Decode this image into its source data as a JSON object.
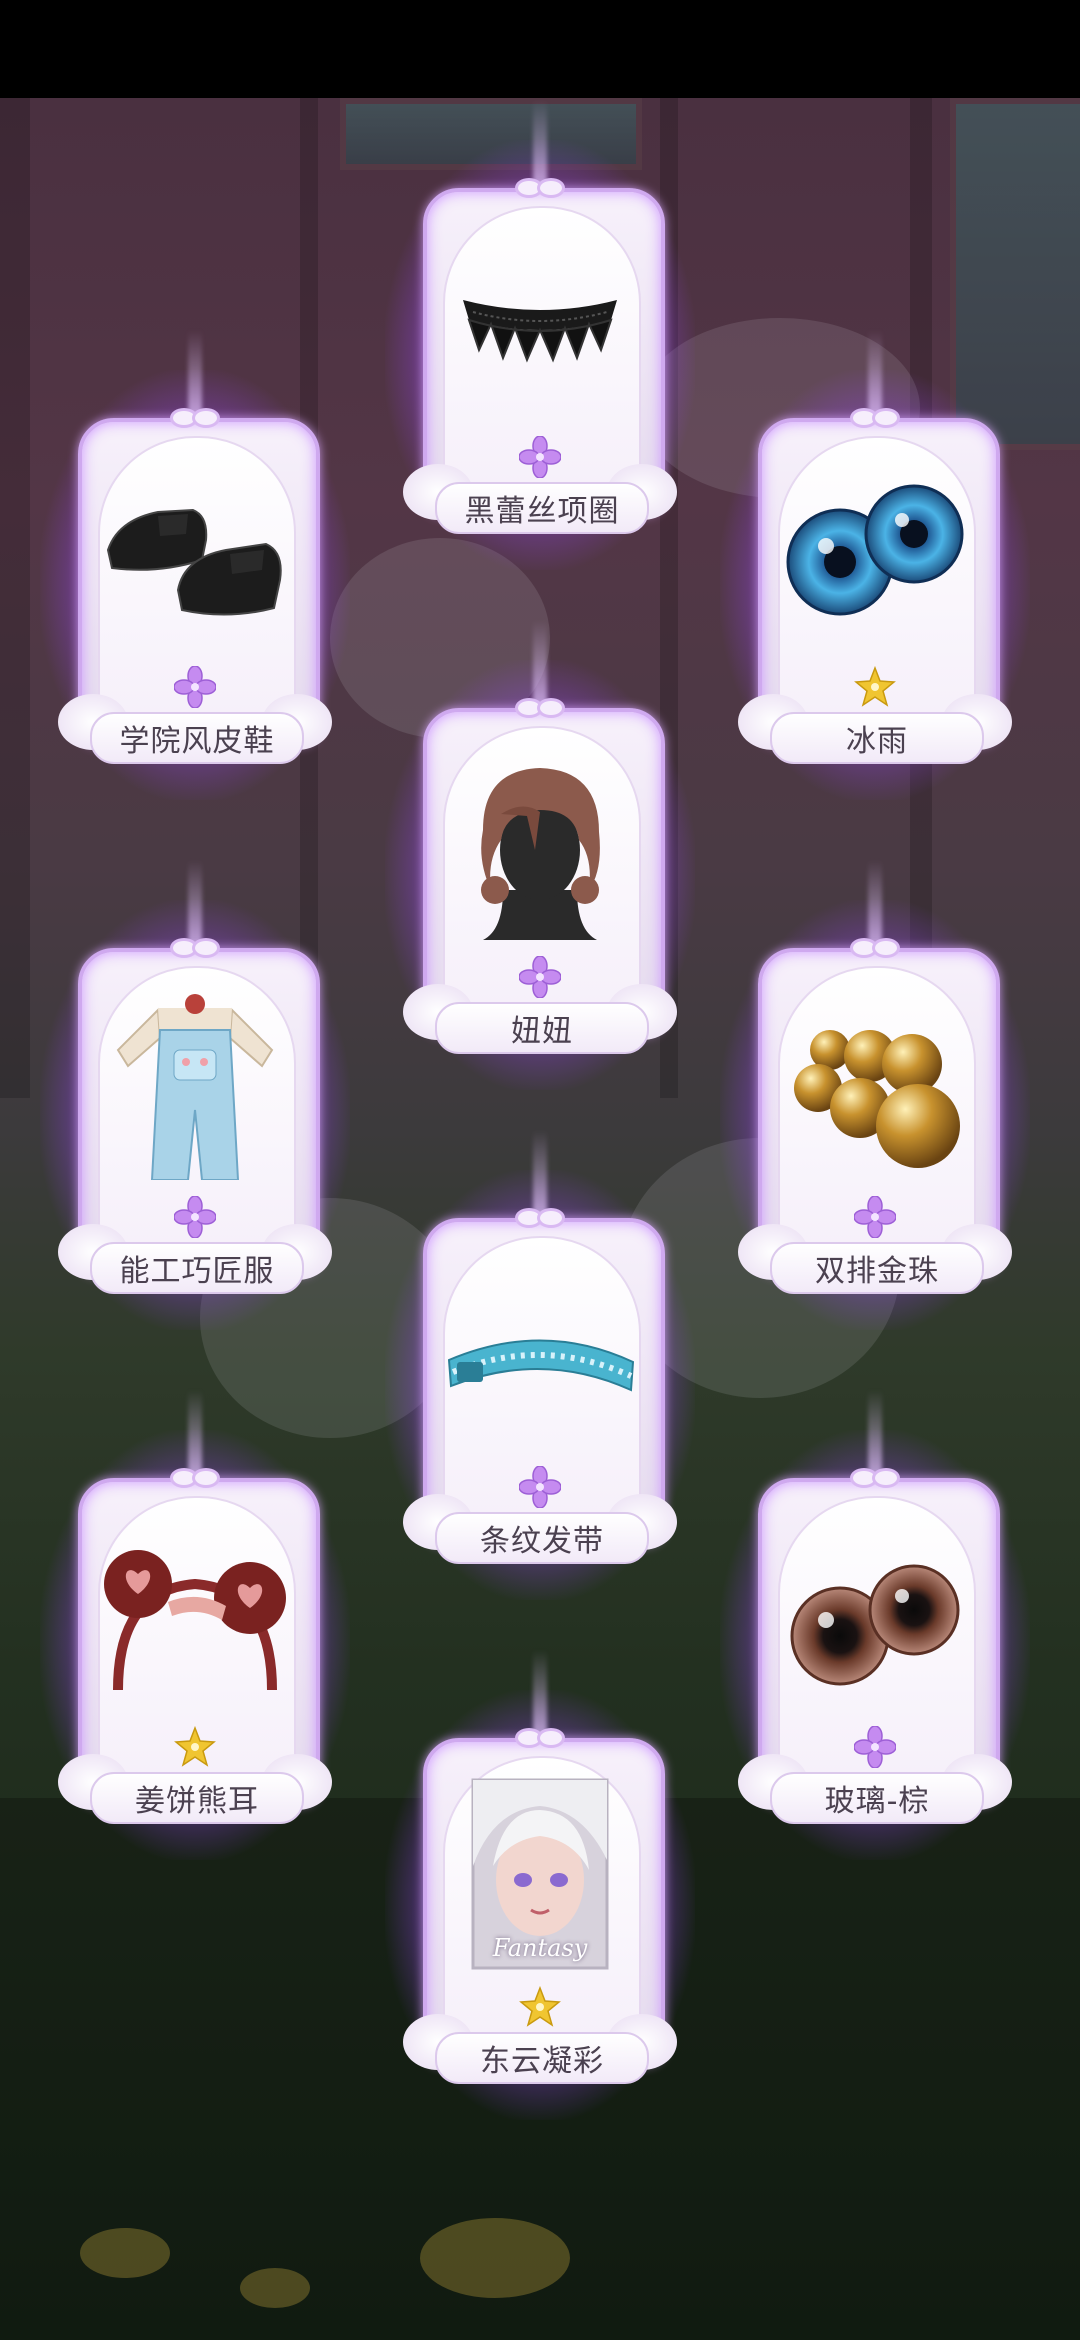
{
  "screen": {
    "title": "",
    "colors": {
      "glow": "#a65cff",
      "frame": "#f2ebf8",
      "label_text": "#4b4150",
      "rarity_purple": "#c58bf0",
      "rarity_gold": "#f0c531"
    }
  },
  "rewards": [
    {
      "label": "黑蕾丝项圈",
      "rarity": "purple",
      "icon": "black-lace-choker-icon"
    },
    {
      "label": "学院风皮鞋",
      "rarity": "purple",
      "icon": "black-leather-shoes-icon"
    },
    {
      "label": "冰雨",
      "rarity": "gold",
      "icon": "blue-eyes-icon"
    },
    {
      "label": "妞妞",
      "rarity": "purple",
      "icon": "brown-bob-hair-icon"
    },
    {
      "label": "能工巧匠服",
      "rarity": "purple",
      "icon": "overalls-outfit-icon"
    },
    {
      "label": "双排金珠",
      "rarity": "purple",
      "icon": "gold-beads-icon"
    },
    {
      "label": "条纹发带",
      "rarity": "purple",
      "icon": "striped-headband-icon"
    },
    {
      "label": "姜饼熊耳",
      "rarity": "gold",
      "icon": "bear-ear-headband-icon"
    },
    {
      "label": "玻璃-棕",
      "rarity": "purple",
      "icon": "brown-glass-eyes-icon"
    },
    {
      "label": "东云凝彩",
      "rarity": "gold",
      "icon": "makeup-portrait-card-icon",
      "card_text": "Fantasy"
    }
  ]
}
